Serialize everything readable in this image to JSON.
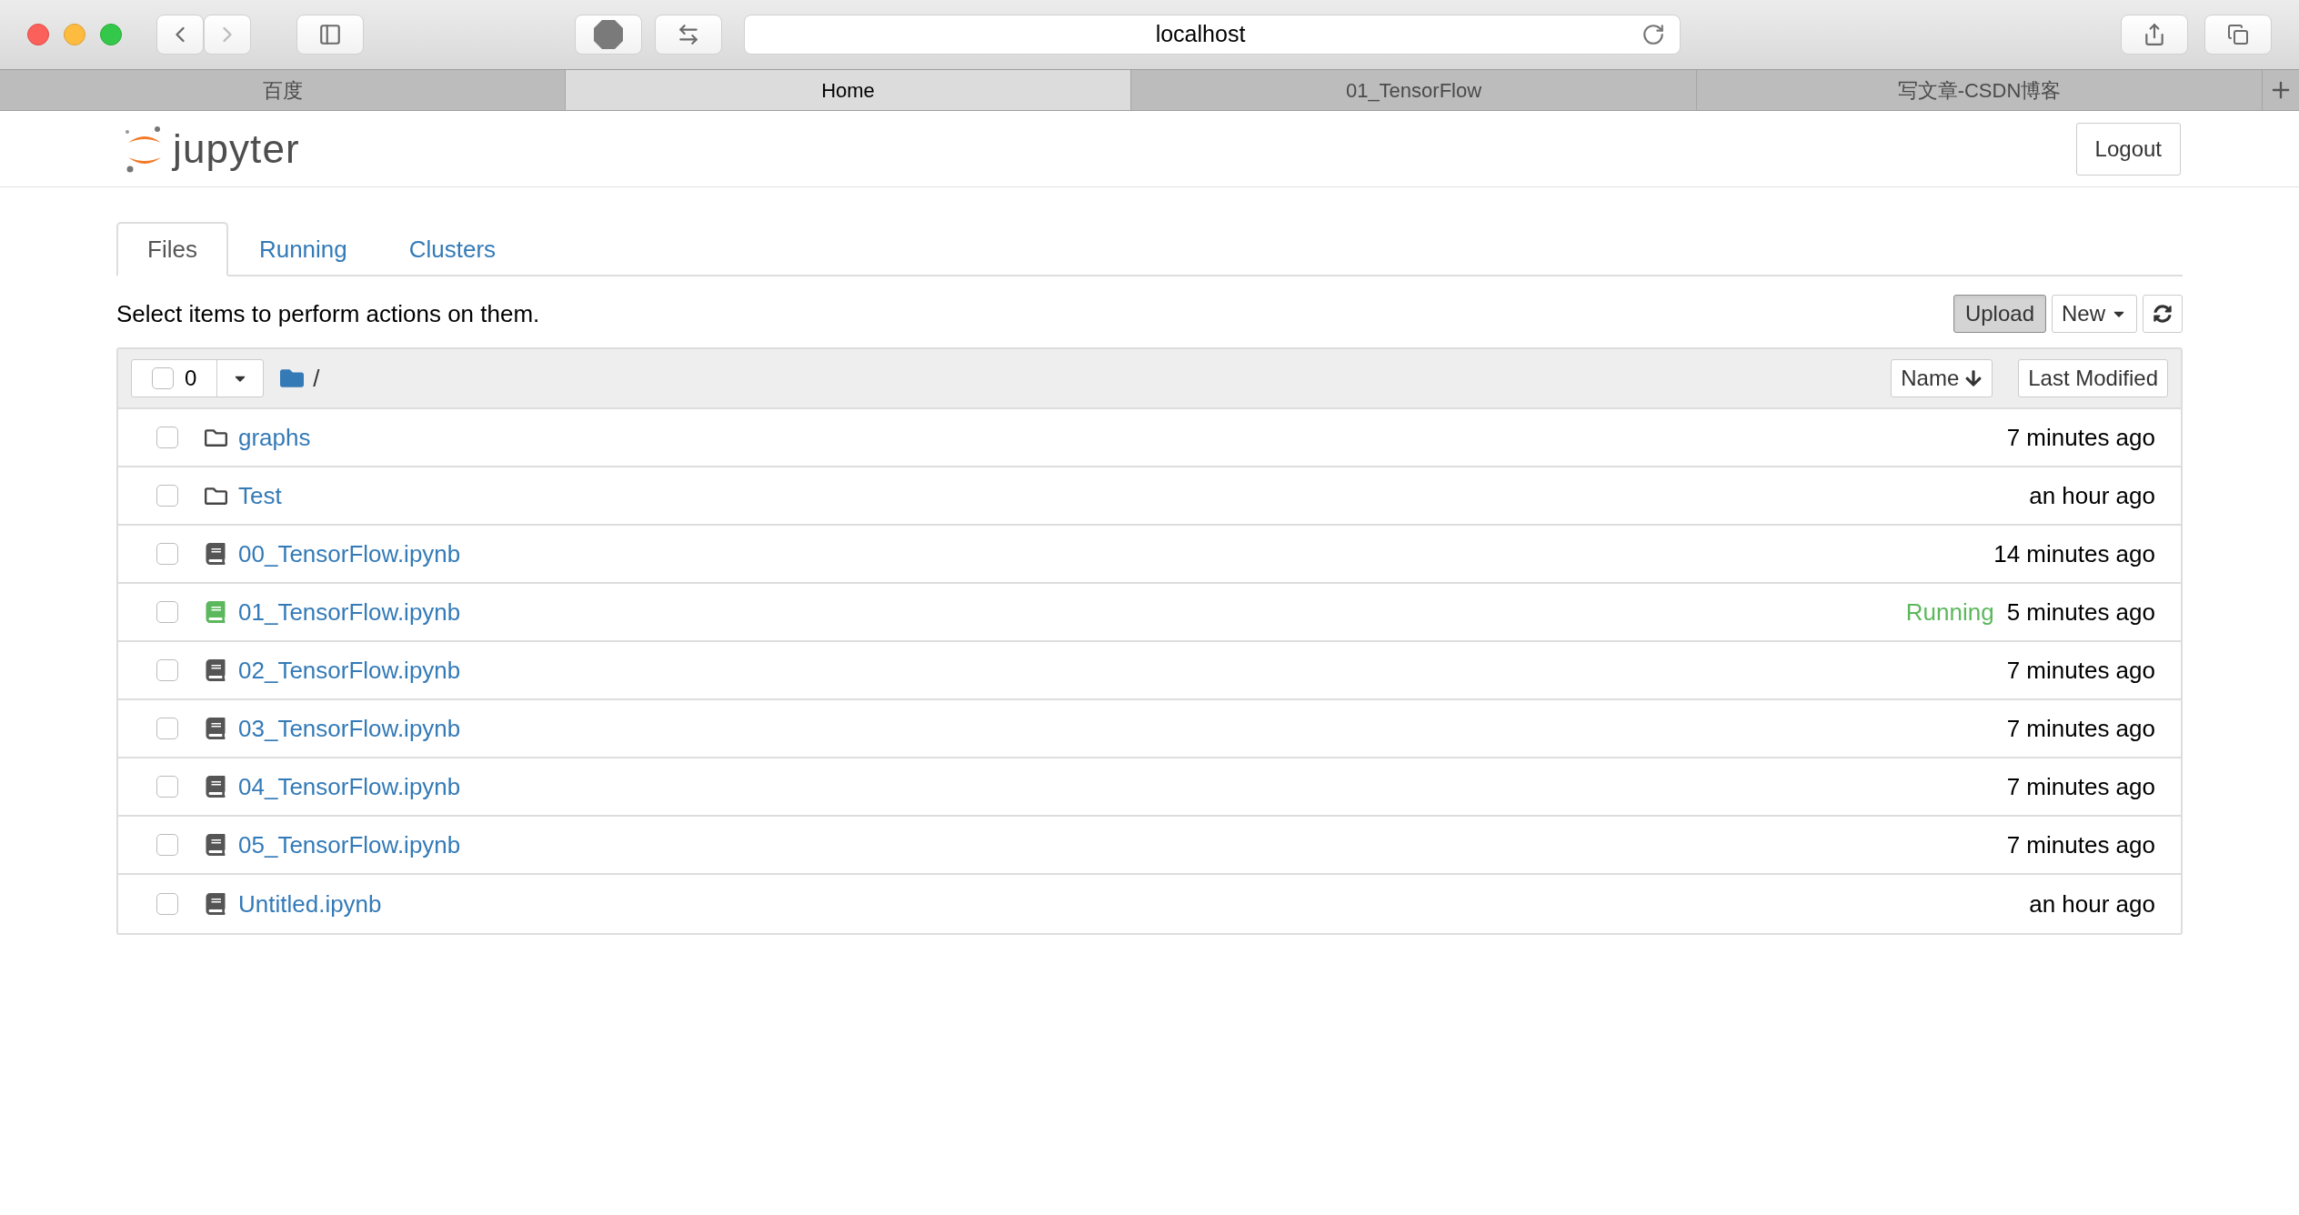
{
  "browser": {
    "address": "localhost",
    "tabs": [
      {
        "label": "百度",
        "selected": false
      },
      {
        "label": "Home",
        "selected": true
      },
      {
        "label": "01_TensorFlow",
        "selected": false
      },
      {
        "label": "写文章-CSDN博客",
        "selected": false
      }
    ]
  },
  "header": {
    "logo_text": "jupyter",
    "logout": "Logout"
  },
  "tabs": [
    {
      "label": "Files",
      "selected": true
    },
    {
      "label": "Running",
      "selected": false
    },
    {
      "label": "Clusters",
      "selected": false
    }
  ],
  "instructions": "Select items to perform actions on them.",
  "actions": {
    "upload": "Upload",
    "new": "New"
  },
  "list_header": {
    "selected_count": "0",
    "checked": false,
    "path": "/",
    "sort_name": "Name",
    "sort_modified": "Last Modified"
  },
  "rows": [
    {
      "kind": "folder",
      "name": "graphs",
      "modified": "7 minutes ago",
      "checked": false
    },
    {
      "kind": "folder",
      "name": "Test",
      "modified": "an hour ago",
      "checked": false
    },
    {
      "kind": "notebook",
      "name": "00_TensorFlow.ipynb",
      "modified": "14 minutes ago",
      "checked": false,
      "running": false
    },
    {
      "kind": "notebook",
      "name": "01_TensorFlow.ipynb",
      "modified": "5 minutes ago",
      "checked": false,
      "running": true,
      "status": "Running"
    },
    {
      "kind": "notebook",
      "name": "02_TensorFlow.ipynb",
      "modified": "7 minutes ago",
      "checked": false,
      "running": false
    },
    {
      "kind": "notebook",
      "name": "03_TensorFlow.ipynb",
      "modified": "7 minutes ago",
      "checked": false,
      "running": false
    },
    {
      "kind": "notebook",
      "name": "04_TensorFlow.ipynb",
      "modified": "7 minutes ago",
      "checked": false,
      "running": false
    },
    {
      "kind": "notebook",
      "name": "05_TensorFlow.ipynb",
      "modified": "7 minutes ago",
      "checked": false,
      "running": false
    },
    {
      "kind": "notebook",
      "name": "Untitled.ipynb",
      "modified": "an hour ago",
      "checked": false,
      "running": false
    }
  ]
}
